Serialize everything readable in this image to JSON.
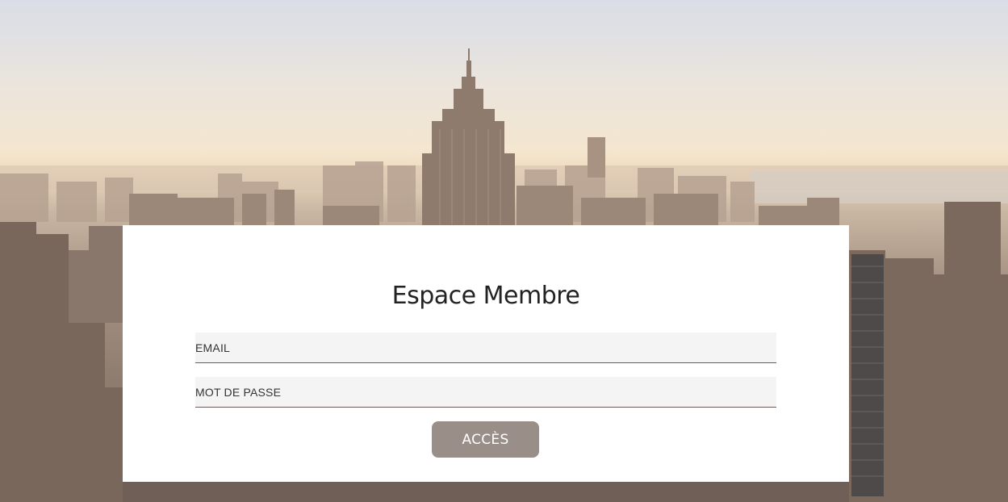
{
  "background": {
    "description_icon": "city-skyline-image"
  },
  "login": {
    "title": "Espace Membre",
    "email_placeholder": "EMAIL",
    "password_placeholder": "MOT DE PASSE",
    "submit_label": "ACCÈS"
  },
  "colors": {
    "button_bg": "#9a8f88",
    "field_bg": "#f4f4f4",
    "field_underline": "#6e5a5a",
    "card_bg": "#ffffff",
    "title_color": "#222222"
  }
}
